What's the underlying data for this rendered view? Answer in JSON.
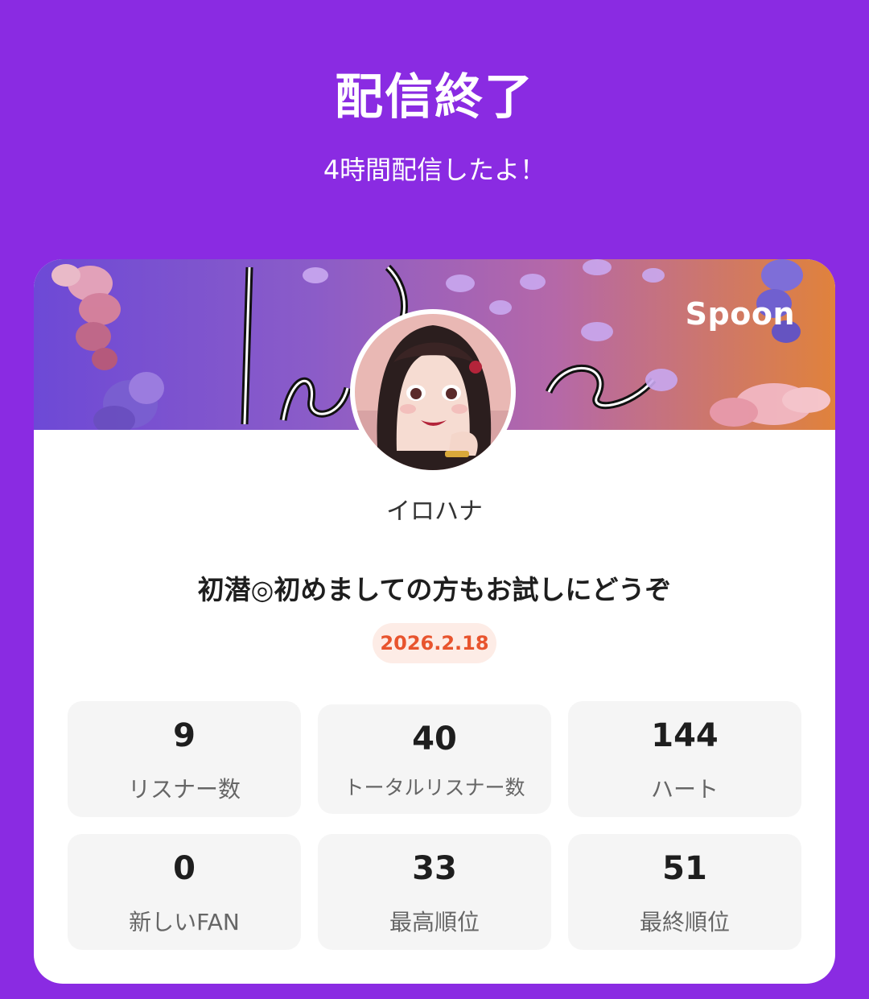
{
  "header": {
    "title": "配信終了",
    "subtitle": "4時間配信したよ！"
  },
  "card": {
    "brand": "Spoon",
    "username": "イロハナ",
    "stream_title": "初潜◎初めましての方もお試しにどうぞ",
    "date": "2026.2.18",
    "stats": [
      {
        "value": "9",
        "label": "リスナー数"
      },
      {
        "value": "40",
        "label": "トータルリスナー数"
      },
      {
        "value": "144",
        "label": "ハート"
      },
      {
        "value": "0",
        "label": "新しいFAN"
      },
      {
        "value": "33",
        "label": "最高順位"
      },
      {
        "value": "51",
        "label": "最終順位"
      }
    ]
  },
  "colors": {
    "background": "#8a2be2",
    "card": "#ffffff",
    "date_badge_bg": "#fdece6",
    "date_badge_text": "#e8542e",
    "stat_bg": "#f5f5f5"
  },
  "icons": {
    "banner": "wisteria-flowers-banner",
    "avatar": "profile-avatar"
  }
}
